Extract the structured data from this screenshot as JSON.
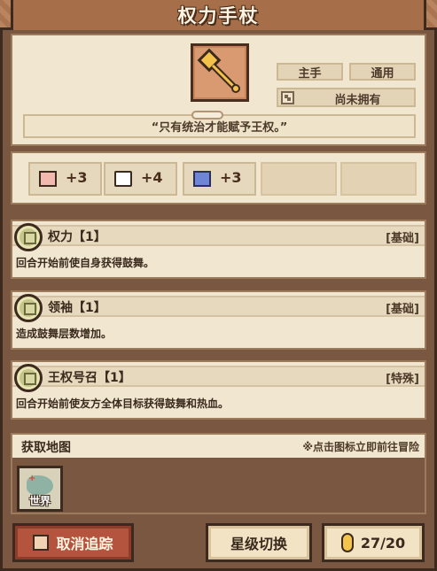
{
  "title": "权力手杖",
  "item": {
    "icon": "golden-scepter-icon",
    "tags": [
      "主手",
      "通用"
    ],
    "ownership": "尚未拥有",
    "quote": "“只有统治才能赋予王权。”"
  },
  "stats": [
    {
      "icon": "fist-icon",
      "value": "+3"
    },
    {
      "icon": "book-icon",
      "value": "+4"
    },
    {
      "icon": "scroll-icon",
      "value": "+3"
    }
  ],
  "skills": [
    {
      "name": "权力【1】",
      "type": "[基础]",
      "desc": "回合开始前使自身获得鼓舞。"
    },
    {
      "name": "领袖【1】",
      "type": "[基础]",
      "desc": "造成鼓舞层数增加。"
    },
    {
      "name": "王权号召【1】",
      "type": "[特殊]",
      "desc": "回合开始前使友方全体目标获得鼓舞和热血。"
    }
  ],
  "map": {
    "title": "获取地图",
    "hint": "※点击图标立即前往冒险",
    "tile_label": "世界"
  },
  "buttons": {
    "cancel_track": "取消追踪",
    "star_switch": "星级切换",
    "coin_count": "27/20"
  }
}
